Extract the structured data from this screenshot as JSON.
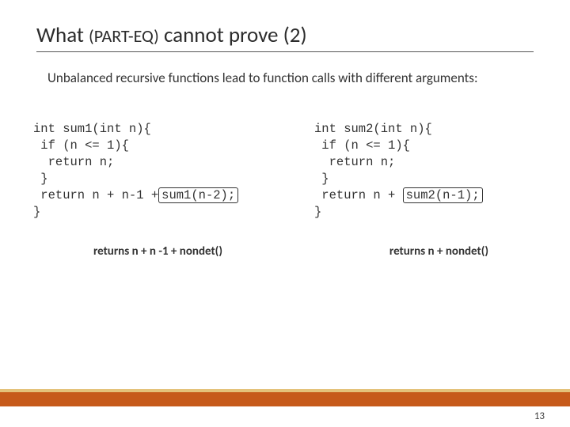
{
  "title_a": "What ",
  "title_b": "(PART-EQ)",
  "title_c": " cannot prove (2)",
  "subtitle": "Unbalanced recursive functions lead to function calls with different arguments:",
  "code_left": {
    "l1": "int sum1(int n){",
    "l2": " if (n <= 1){",
    "l3": "  return n;",
    "l4": " }",
    "l5a": " return n + n-1 +",
    "l5b": "sum1(n-2);",
    "l6": "}"
  },
  "code_right": {
    "l1": "int sum2(int n){",
    "l2": " if (n <= 1){",
    "l3": "  return n;",
    "l4": " }",
    "l5a": " return n + ",
    "l5b": "sum2(n-1);",
    "l6": "}"
  },
  "caption_left": "returns n + n -1 + nondet()",
  "caption_right": "returns n + nondet()",
  "page": "13"
}
